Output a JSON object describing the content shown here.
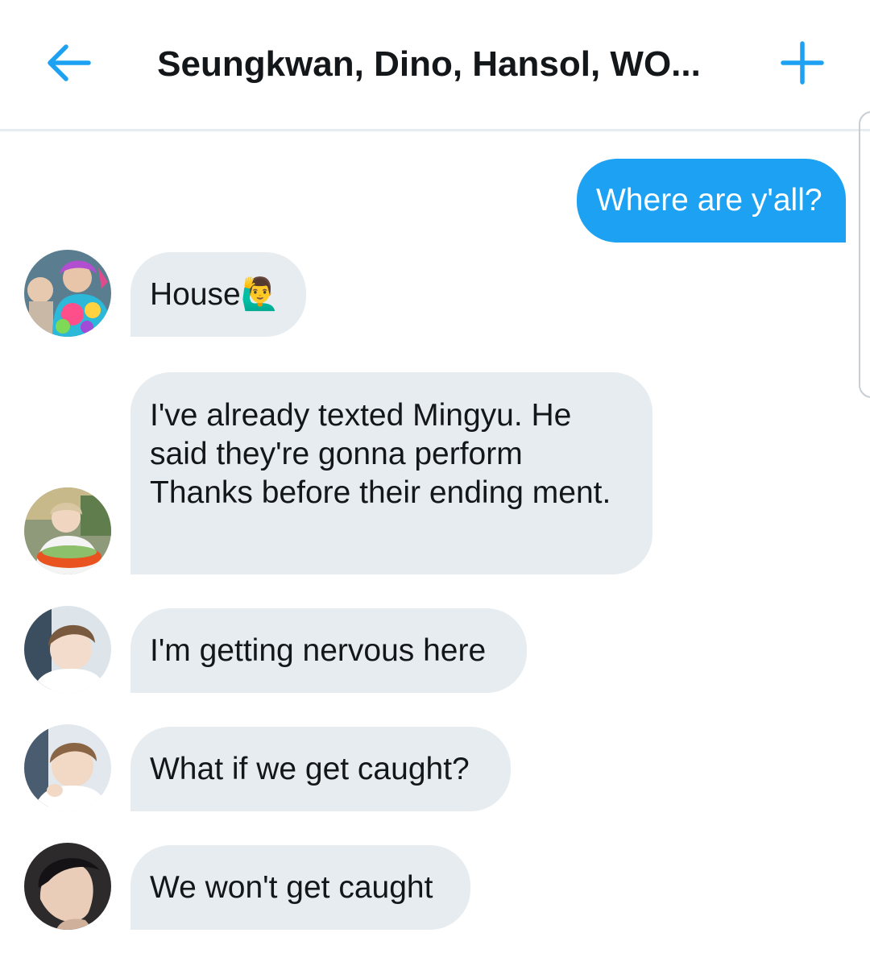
{
  "header": {
    "title": "Seungkwan, Dino, Hansol, WO...",
    "back_icon": "arrow-left-icon",
    "add_icon": "plus-icon",
    "accent_color": "#1da1f2"
  },
  "messages": [
    {
      "sender": "me",
      "text": "Where are y'all?"
    },
    {
      "sender": "other",
      "text": "House🙋‍♂️"
    },
    {
      "sender": "other",
      "text": "I've already texted Mingyu. He said they're gonna perform Thanks before their ending ment."
    },
    {
      "sender": "other",
      "text": "I'm getting nervous here"
    },
    {
      "sender": "other",
      "text": "What if we get caught?"
    },
    {
      "sender": "other",
      "text": "We won't get caught"
    }
  ],
  "colors": {
    "outgoing_bubble": "#1da1f2",
    "incoming_bubble": "#e6ecf0",
    "text": "#14171a"
  }
}
